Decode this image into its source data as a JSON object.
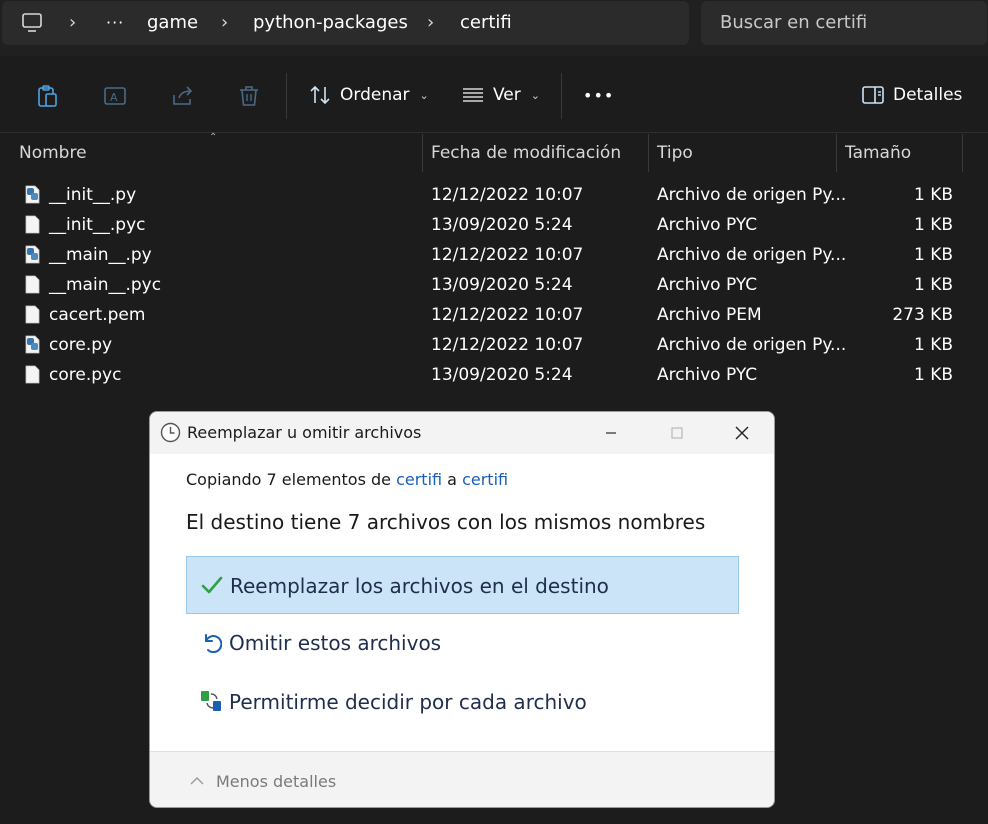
{
  "address_bar": {
    "overflow": "···",
    "crumbs": [
      "game",
      "python-packages",
      "certifi"
    ],
    "chevron": "›",
    "search_placeholder": "Buscar en certifi"
  },
  "toolbar": {
    "sort_label": "Ordenar",
    "view_label": "Ver",
    "more_label": "•••",
    "details_label": "Detalles"
  },
  "columns": {
    "name": "Nombre",
    "modified": "Fecha de modificación",
    "type": "Tipo",
    "size": "Tamaño"
  },
  "files": [
    {
      "name": "__init__.py",
      "modified": "12/12/2022 10:07",
      "type": "Archivo de origen Py...",
      "size": "1 KB",
      "icon": "python-file-icon"
    },
    {
      "name": "__init__.pyc",
      "modified": "13/09/2020 5:24",
      "type": "Archivo PYC",
      "size": "1 KB",
      "icon": "file-icon"
    },
    {
      "name": "__main__.py",
      "modified": "12/12/2022 10:07",
      "type": "Archivo de origen Py...",
      "size": "1 KB",
      "icon": "python-file-icon"
    },
    {
      "name": "__main__.pyc",
      "modified": "13/09/2020 5:24",
      "type": "Archivo PYC",
      "size": "1 KB",
      "icon": "file-icon"
    },
    {
      "name": "cacert.pem",
      "modified": "12/12/2022 10:07",
      "type": "Archivo PEM",
      "size": "273 KB",
      "icon": "file-icon"
    },
    {
      "name": "core.py",
      "modified": "12/12/2022 10:07",
      "type": "Archivo de origen Py...",
      "size": "1 KB",
      "icon": "python-file-icon"
    },
    {
      "name": "core.pyc",
      "modified": "13/09/2020 5:24",
      "type": "Archivo PYC",
      "size": "1 KB",
      "icon": "file-icon"
    }
  ],
  "dialog": {
    "title": "Reemplazar u omitir archivos",
    "copy_prefix": "Copiando 7 elementos de ",
    "source": "certifi",
    "copy_mid": " a ",
    "destination": "certifi",
    "heading": "El destino tiene 7 archivos con los mismos nombres",
    "options": [
      {
        "label": "Reemplazar los archivos en el destino",
        "icon": "checkmark-icon"
      },
      {
        "label": "Omitir estos archivos",
        "icon": "undo-arrow-icon"
      },
      {
        "label": "Permitirme decidir por cada archivo",
        "icon": "compare-files-icon"
      }
    ],
    "less_details": "Menos detalles"
  },
  "colors": {
    "background": "#1c1c1c",
    "link": "#1a5fb4",
    "selected_option": "#cce4f7",
    "check_green": "#2ea043"
  }
}
